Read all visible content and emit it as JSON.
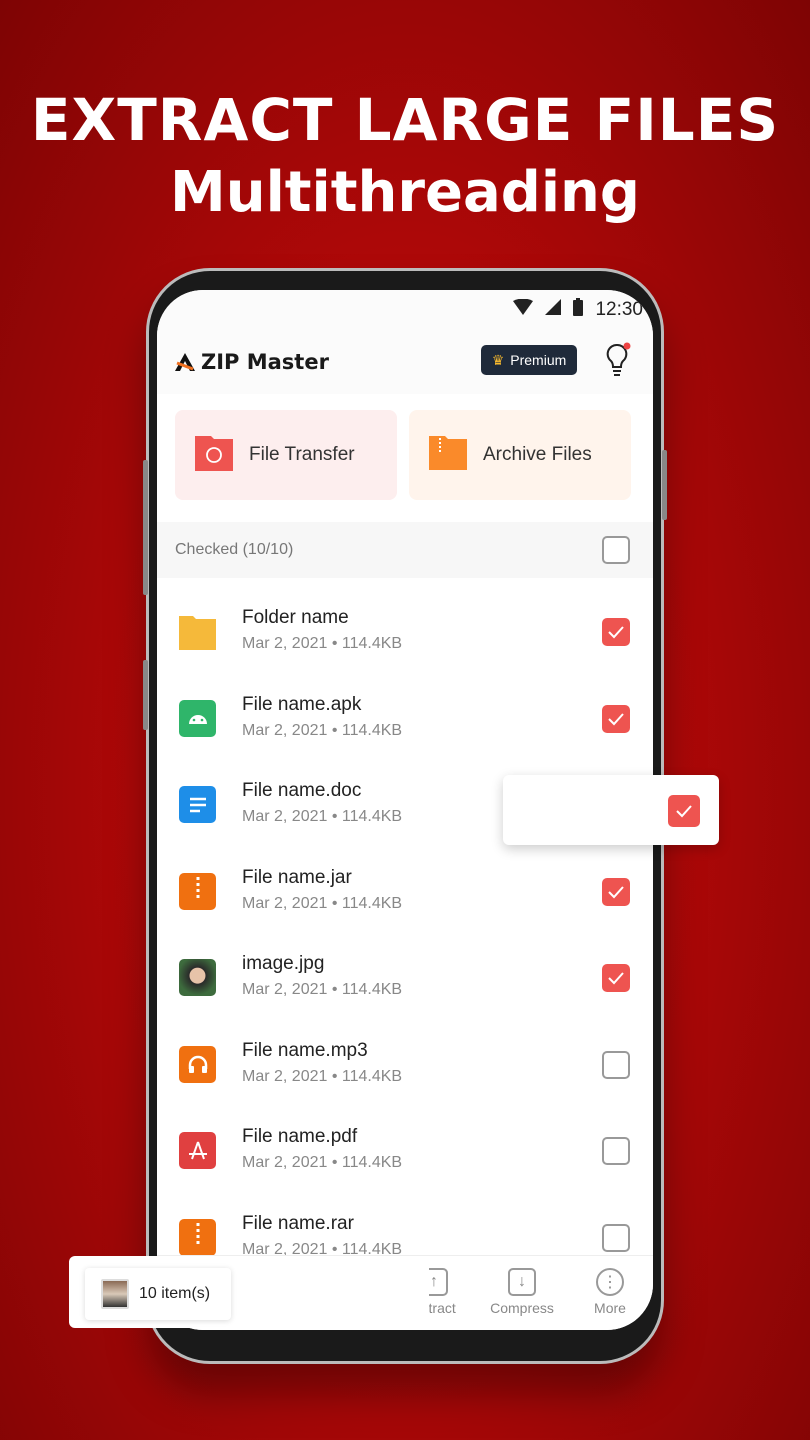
{
  "headline": {
    "line1": "EXTRACT LARGE FILES",
    "line2": "Multithreading"
  },
  "status_bar": {
    "time": "12:30"
  },
  "app": {
    "name": "ZIP Master",
    "premium_label": "Premium"
  },
  "cards": [
    {
      "label": "File Transfer",
      "color": "#ee5450"
    },
    {
      "label": "Archive Files",
      "color": "#fa8a2a"
    }
  ],
  "checked_label": "Checked (10/10)",
  "files": [
    {
      "name": "Folder name",
      "meta": "Mar 2, 2021 • 114.4KB",
      "icon": "folder-icon",
      "checked": true
    },
    {
      "name": "File name.apk",
      "meta": "Mar 2, 2021 • 114.4KB",
      "icon": "android-icon",
      "checked": true
    },
    {
      "name": "File name.doc",
      "meta": "Mar 2, 2021 • 114.4KB",
      "icon": "doc-icon",
      "checked": true
    },
    {
      "name": "File name.jar",
      "meta": "Mar 2, 2021 • 114.4KB",
      "icon": "zip-icon",
      "checked": true
    },
    {
      "name": "image.jpg",
      "meta": "Mar 2, 2021 • 114.4KB",
      "icon": "image-thumbnail",
      "checked": true
    },
    {
      "name": "File name.mp3",
      "meta": "Mar 2, 2021 • 114.4KB",
      "icon": "headphones-icon",
      "checked": false
    },
    {
      "name": "File name.pdf",
      "meta": "Mar 2, 2021 • 114.4KB",
      "icon": "pdf-icon",
      "checked": false
    },
    {
      "name": "File name.rar",
      "meta": "Mar 2, 2021 • 114.4KB",
      "icon": "zip-icon",
      "checked": false
    }
  ],
  "bottom_bar": {
    "extract": "Extract",
    "compress": "Compress",
    "more": "More"
  },
  "selection": {
    "count_label": "10 item(s)"
  },
  "colors": {
    "accent": "#ee5450",
    "background": "#b00808"
  }
}
